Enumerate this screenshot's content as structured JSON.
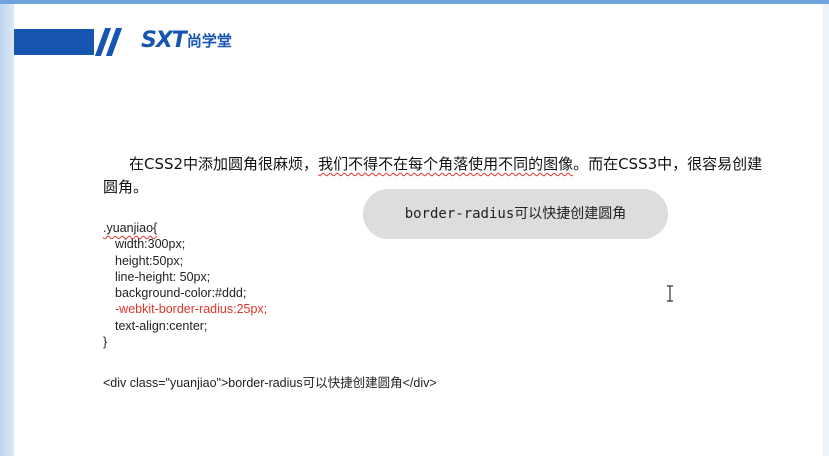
{
  "logo": {
    "brand": "SXT",
    "name_cn": "尚学堂"
  },
  "intro": {
    "part1": "在CSS2中添加圆角很麻烦，",
    "part2": "我们不得不在每个角落使用不同的图像",
    "part3": "。而在CSS3中，很容易创建圆角。"
  },
  "demo": {
    "label": "border-radius可以快捷创建圆角"
  },
  "css_code": {
    "selector": ".yuanjiao{",
    "width": "width:300px;",
    "height": "height:50px;",
    "line_height": "line-height: 50px;",
    "background": "background-color:#ddd;",
    "webkit_radius": "-webkit-border-radius:25px;",
    "text_align": "text-align:center;",
    "close": "}"
  },
  "html_code": "<div class=\"yuanjiao\">border-radius可以快捷创建圆角</div>"
}
